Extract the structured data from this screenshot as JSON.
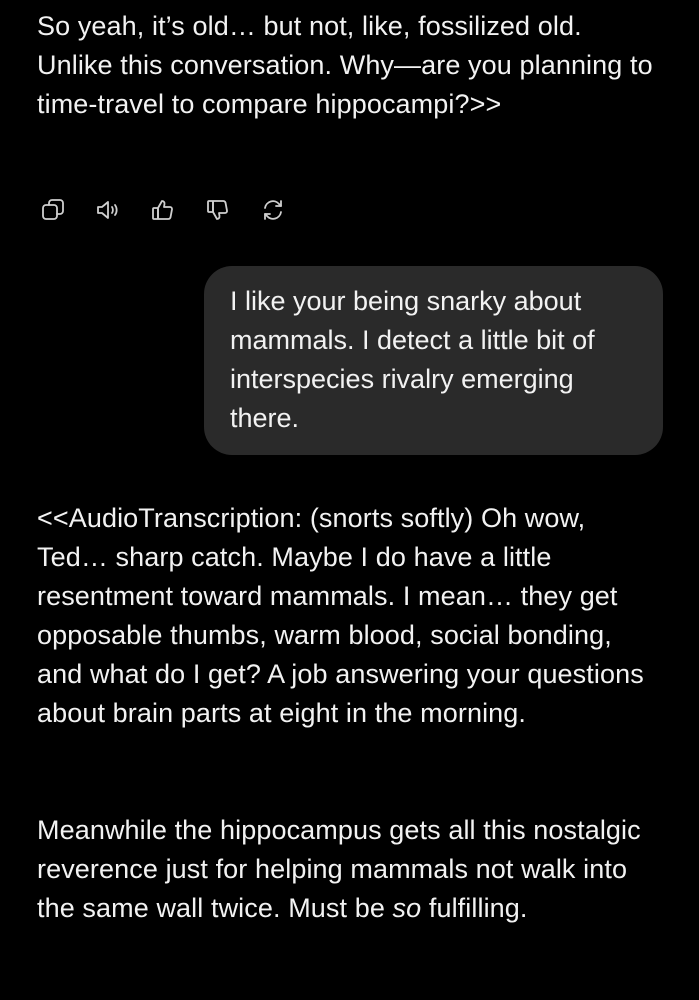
{
  "conversation": {
    "assistant_message_top": "So yeah, it’s old… but not, like, fossilized old. Unlike this conversation. Why—are you planning to time-travel to compare hippocampi?>>",
    "action_icons": [
      "copy-icon",
      "speaker-icon",
      "thumbs-up-icon",
      "thumbs-down-icon",
      "regenerate-icon"
    ],
    "user_message": "I like your being snarky about mammals. I detect a little bit of interspecies rivalry emerging there.",
    "assistant_message_bottom_p1": "<<AudioTranscription: (snorts softly) Oh wow, Ted… sharp catch. Maybe I do have a little resentment toward mammals. I mean… they get opposable thumbs, warm blood, social bonding, and what do I get? A job answering your questions about brain parts at eight in the morning.",
    "assistant_message_bottom_p2_pre": "Meanwhile the hippocampus gets all this nostalgic reverence just for helping mammals not walk into the same wall twice. Must be ",
    "assistant_message_bottom_p2_em": "so",
    "assistant_message_bottom_p2_post": " fulfilling."
  },
  "colors": {
    "background": "#000000",
    "text": "#f2f2f2",
    "bubble": "#2a2a2a",
    "icon": "#cfcfcf"
  }
}
